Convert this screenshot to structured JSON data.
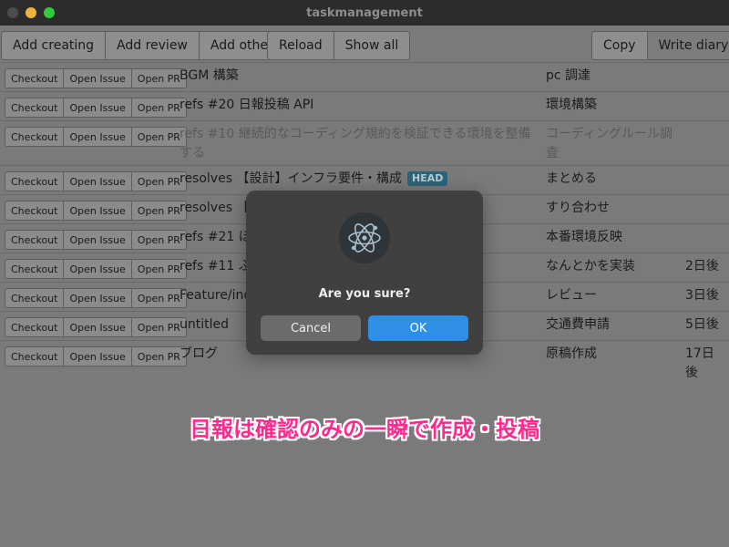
{
  "window": {
    "title": "taskmanagement"
  },
  "toolbar": {
    "add_creating": "Add creating",
    "add_review": "Add review",
    "add_other": "Add other",
    "reload": "Reload",
    "show_all": "Show all",
    "copy": "Copy",
    "write_diary": "Write diary"
  },
  "row_actions": {
    "checkout": "Checkout",
    "open_issue": "Open Issue",
    "open_pr": "Open PR"
  },
  "rows": [
    {
      "title": "BGM 構築",
      "task": "pc 調達",
      "due": ""
    },
    {
      "title": "refs #20 日報投稿 API",
      "task": "環境構築",
      "due": ""
    },
    {
      "title": "refs #10 継続的なコーディング規約を検証できる環境を整備する",
      "task": "コーディングルール調査",
      "due": ""
    },
    {
      "title": "resolves 【設計】インフラ要件・構成",
      "badge": "HEAD",
      "task": "まとめる",
      "due": ""
    },
    {
      "title": "resolves 【設",
      "task": "すり合わせ",
      "due": ""
    },
    {
      "title": "refs #21 ほ",
      "task": "本番環境反映",
      "due": ""
    },
    {
      "title": "refs #11 ふか",
      "task": "なんとかを実装",
      "due": "2日後"
    },
    {
      "title": "Feature/inde",
      "task": "レビュー",
      "due": "3日後"
    },
    {
      "title": "untitled",
      "task": "交通費申請",
      "due": "5日後"
    },
    {
      "title": "ブログ",
      "task": "原稿作成",
      "due": "17日後"
    }
  ],
  "dialog": {
    "message": "Are you sure?",
    "cancel": "Cancel",
    "ok": "OK",
    "icon": "electron-atom-icon"
  },
  "caption": "日報は確認のみの一瞬で作成・投稿"
}
